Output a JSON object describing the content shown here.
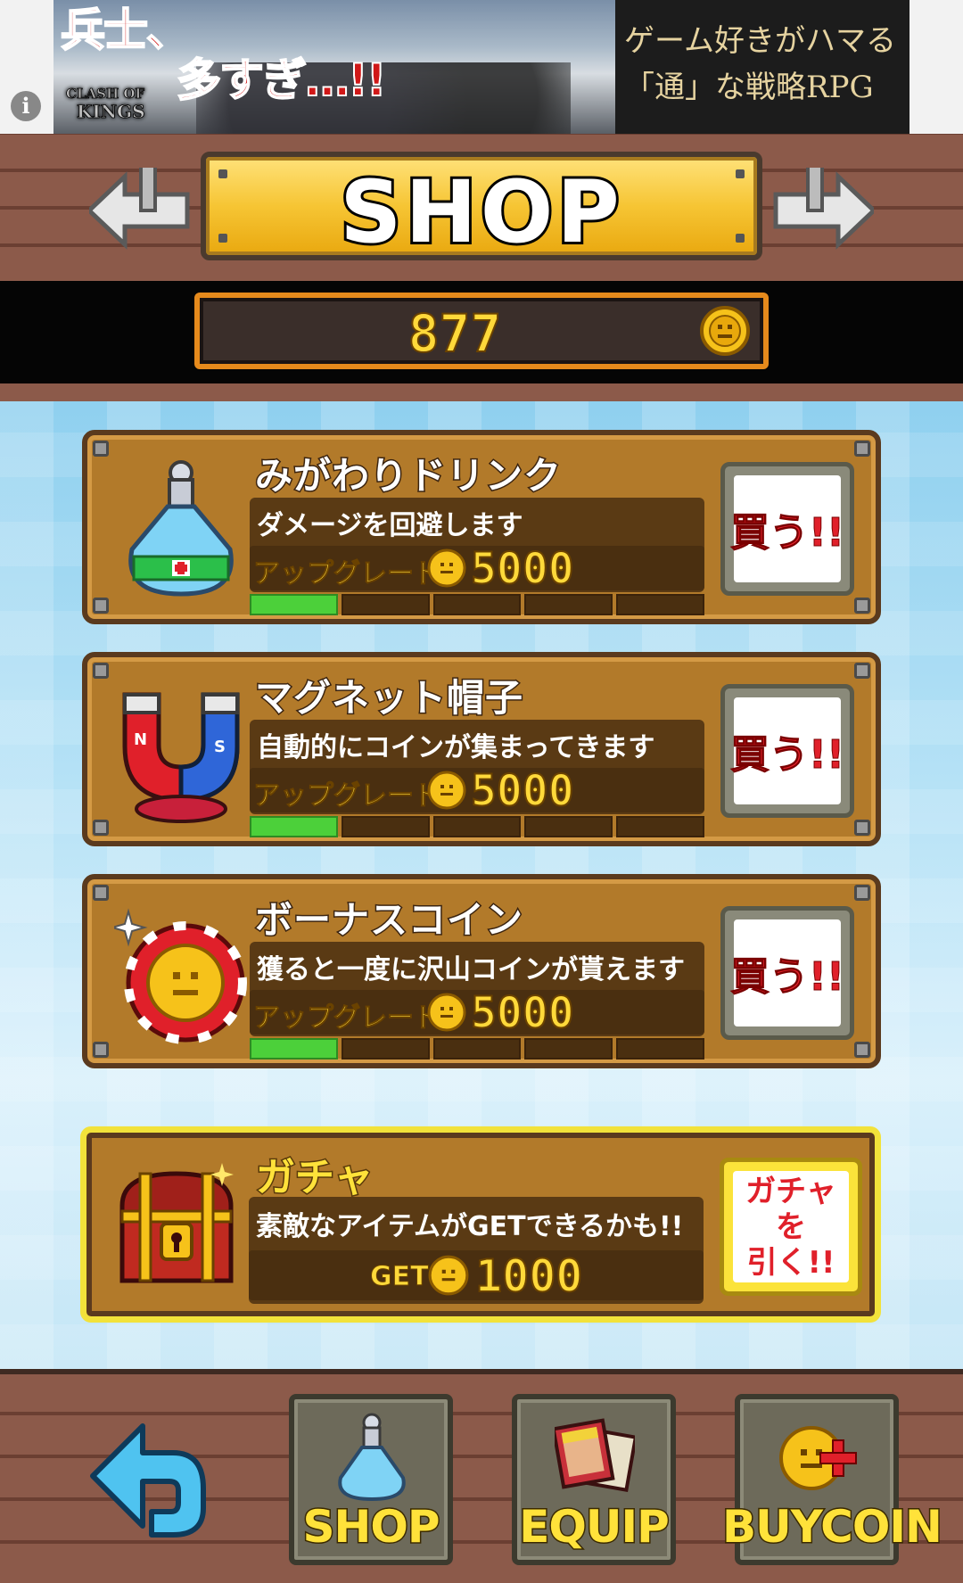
{
  "ad": {
    "headline_1": "兵士、",
    "headline_2": "多すぎ…!!",
    "logo": "CLASH OF KINGS",
    "tagline_1": "ゲーム好きがハマる",
    "tagline_2": "「通」な戦略RPG",
    "info_icon": "info-icon"
  },
  "header": {
    "title": "SHOP",
    "coins": "877"
  },
  "items": [
    {
      "name": "みがわりドリンク",
      "description": "ダメージを回避します",
      "upgrade_label": "アップグレード",
      "price": "5000",
      "level": 1,
      "max_level": 5,
      "buy_label": "買う!!",
      "icon": "potion-icon"
    },
    {
      "name": "マグネット帽子",
      "description": "自動的にコインが集まってきます",
      "upgrade_label": "アップグレード",
      "price": "5000",
      "level": 1,
      "max_level": 5,
      "buy_label": "買う!!",
      "icon": "magnet-icon"
    },
    {
      "name": "ボーナスコイン",
      "description": "獲ると一度に沢山コインが貰えます",
      "upgrade_label": "アップグレード",
      "price": "5000",
      "level": 1,
      "max_level": 5,
      "buy_label": "買う!!",
      "icon": "bonus-coin-icon"
    }
  ],
  "gacha": {
    "name": "ガチャ",
    "description": "素敵なアイテムがGETできるかも!!",
    "get_label": "GET",
    "price": "1000",
    "button_label": "ガチャを\n引く!!",
    "icon": "treasure-chest-icon"
  },
  "nav": {
    "shop": "SHOP",
    "equip": "EQUIP",
    "buycoin": "BUYCOIN"
  },
  "colors": {
    "card_brown": "#b27a2a",
    "gold_text": "#ffd93a",
    "buy_red": "#e0202a",
    "level_green": "#4cd03a",
    "gacha_border": "#f2e23a"
  }
}
